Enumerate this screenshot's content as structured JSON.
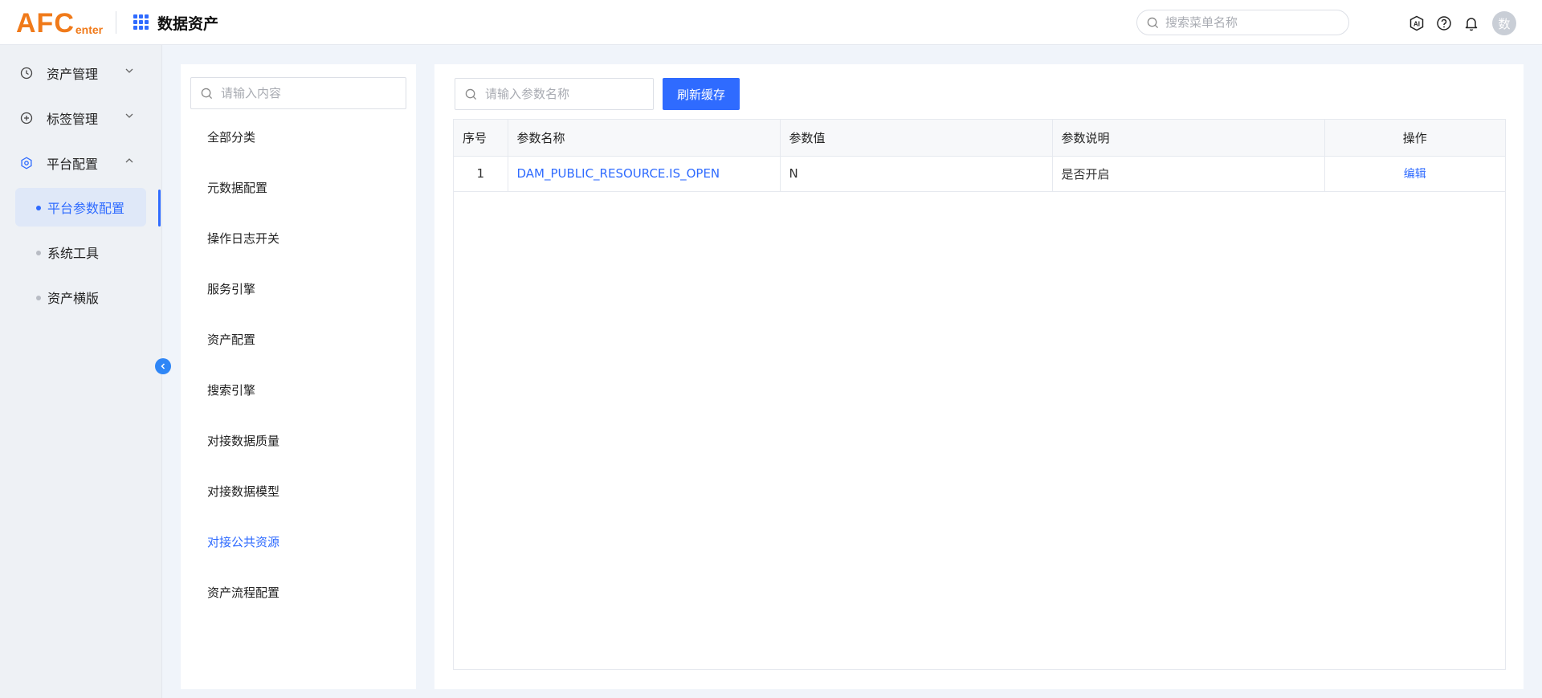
{
  "header": {
    "logo_main": "AFC",
    "logo_sub": "enter",
    "app_title": "数据资产",
    "search_placeholder": "搜索菜单名称",
    "avatar_text": "数"
  },
  "sidebar": {
    "groups": [
      {
        "label": "资产管理",
        "icon": "clock-icon",
        "expanded": false
      },
      {
        "label": "标签管理",
        "icon": "plus-circle-icon",
        "expanded": false
      },
      {
        "label": "平台配置",
        "icon": "settings-icon",
        "expanded": true
      }
    ],
    "sub_items": [
      {
        "label": "平台参数配置",
        "selected": true
      },
      {
        "label": "系统工具",
        "selected": false
      },
      {
        "label": "资产横版",
        "selected": false
      }
    ]
  },
  "categories": {
    "search_placeholder": "请输入内容",
    "items": [
      "全部分类",
      "元数据配置",
      "操作日志开关",
      "服务引擎",
      "资产配置",
      "搜索引擎",
      "对接数据质量",
      "对接数据模型",
      "对接公共资源",
      "资产流程配置"
    ],
    "selected_index": 8
  },
  "params": {
    "search_placeholder": "请输入参数名称",
    "refresh_label": "刷新缓存",
    "columns": [
      "序号",
      "参数名称",
      "参数值",
      "参数说明",
      "操作"
    ],
    "rows": [
      {
        "index": "1",
        "name": "DAM_PUBLIC_RESOURCE.IS_OPEN",
        "value": "N",
        "desc": "是否开启",
        "action": "编辑"
      }
    ]
  },
  "colors": {
    "accent": "#2f6bff",
    "logo": "#f07a1a"
  }
}
